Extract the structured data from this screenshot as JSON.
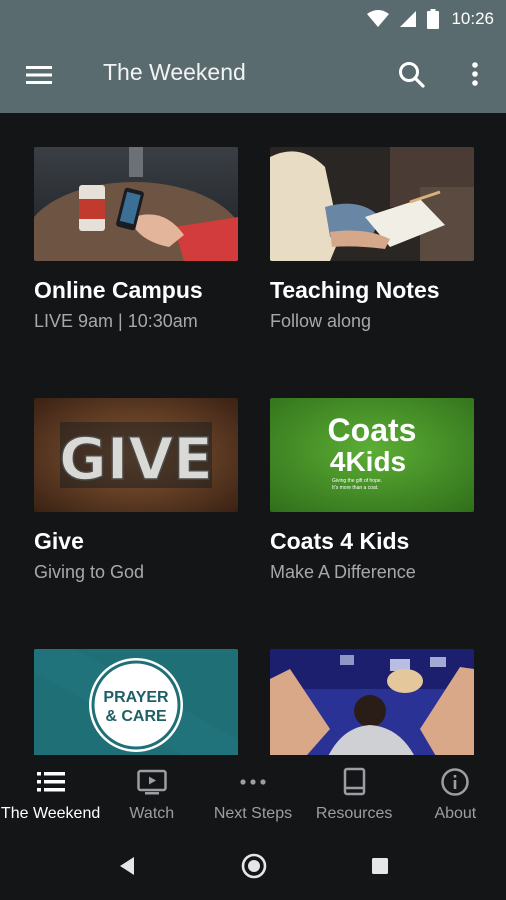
{
  "status_bar": {
    "time": "10:26",
    "icons": [
      "wifi-icon",
      "cell-signal-icon",
      "battery-icon"
    ]
  },
  "app_bar": {
    "title": "The Weekend",
    "icons": [
      "menu-icon",
      "search-icon",
      "more-vert-icon"
    ]
  },
  "cards": [
    {
      "title": "Online Campus",
      "subtitle": "LIVE 9am | 10:30am"
    },
    {
      "title": "Teaching Notes",
      "subtitle": "Follow along"
    },
    {
      "title": "Give",
      "subtitle": "Giving to God",
      "image_text": "GIVE"
    },
    {
      "title": "Coats 4 Kids",
      "subtitle": "Make A Difference",
      "image_text": {
        "line1": "Coats",
        "line2": "4Kids",
        "tagline1": "Giving the gift of hope.",
        "tagline2": "It's more than a coat."
      }
    },
    {
      "title": "",
      "subtitle": "",
      "image_text": {
        "line1": "PRAYER",
        "line2": "& CARE"
      }
    },
    {
      "title": "",
      "subtitle": ""
    }
  ],
  "bottom_nav": [
    {
      "label": "The Weekend",
      "icon": "list-icon",
      "active": true
    },
    {
      "label": "Watch",
      "icon": "tv-icon",
      "active": false
    },
    {
      "label": "Next Steps",
      "icon": "more-horiz-icon",
      "active": false
    },
    {
      "label": "Resources",
      "icon": "book-icon",
      "active": false
    },
    {
      "label": "About",
      "icon": "info-icon",
      "active": false
    }
  ],
  "system_nav": [
    "back-icon",
    "home-icon",
    "recents-icon"
  ],
  "colors": {
    "app_bar": "#5a6b70",
    "background": "#141517",
    "subtitle": "#a6a9ac",
    "coats_green": "#4c9a2a",
    "prayer_teal": "#1f6f76"
  }
}
